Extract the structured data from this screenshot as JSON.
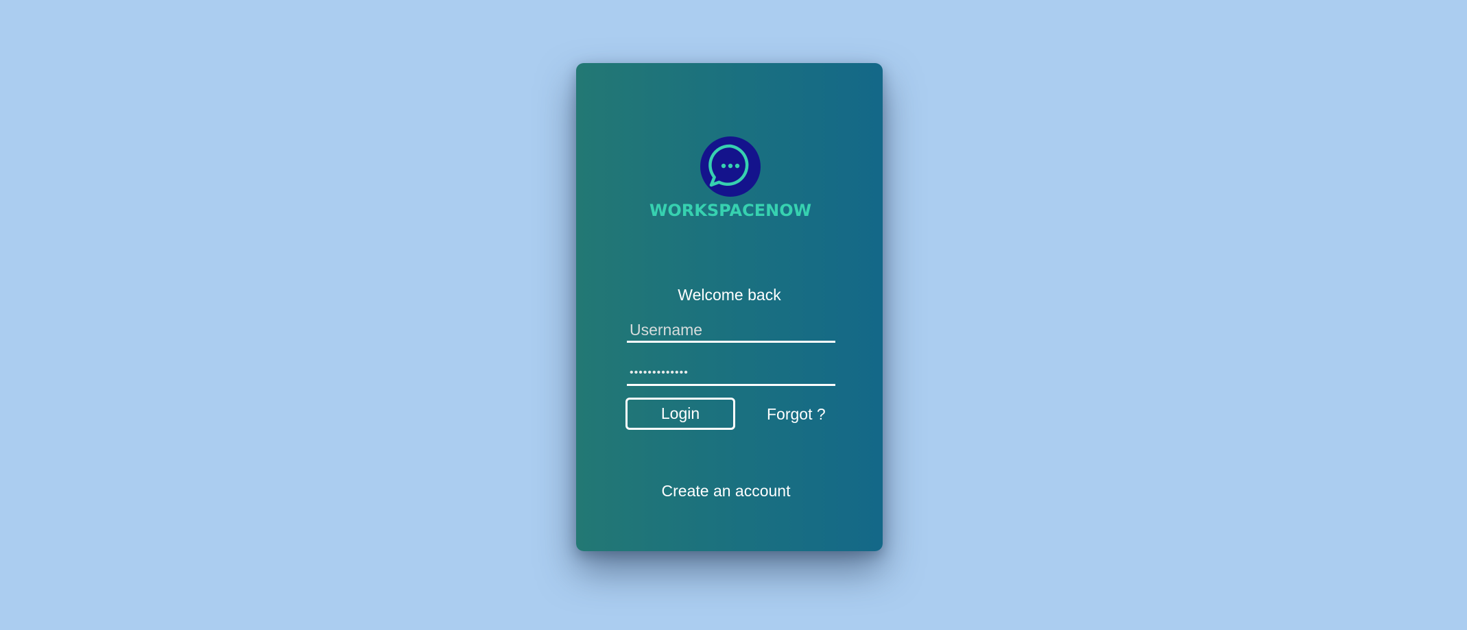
{
  "brand": {
    "logo_icon": "chat-bubble-icon",
    "name": "WORKSPACENOW"
  },
  "login": {
    "welcome": "Welcome back",
    "username_placeholder": "Username",
    "username_value": "",
    "password_masked": "•••••••••••••",
    "login_label": "Login",
    "forgot_label": "Forgot ?",
    "create_label": "Create an account"
  },
  "colors": {
    "background": "#abcdf0",
    "card_gradient_start": "#237874",
    "card_gradient_end": "#146888",
    "logo_circle": "#14138c",
    "brand_accent": "#37d1b0",
    "text": "#ffffff"
  }
}
